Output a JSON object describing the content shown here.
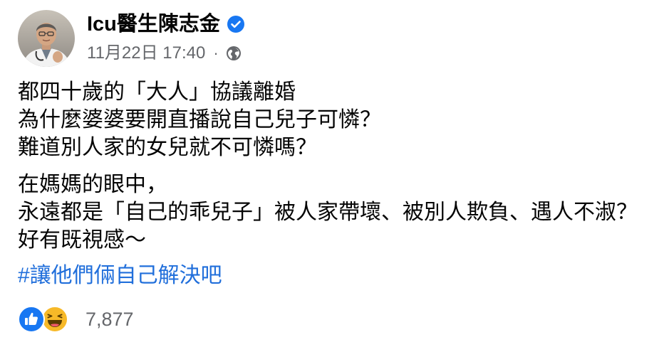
{
  "post": {
    "author": {
      "name": "Icu醫生陳志金",
      "verified": true
    },
    "timestamp": "11月22日 17:40",
    "separator": "·",
    "audience_icon": "globe-icon",
    "paragraphs": [
      {
        "lines": [
          "都四十歲的「大人」協議離婚",
          "為什麼婆婆要開直播說自己兒子可憐？",
          "難道別人家的女兒就不可憐嗎？"
        ]
      },
      {
        "lines": [
          "在媽媽的眼中，",
          "永遠都是「自己的乖兒子」被人家帶壞、被別人欺負、遇人不淑？",
          "好有既視感～"
        ]
      }
    ],
    "hashtag": "#讓他們倆自己解決吧",
    "reactions": {
      "icons": [
        "like-reaction-icon",
        "haha-reaction-icon"
      ],
      "count": "7,877"
    }
  },
  "colors": {
    "text": "#050505",
    "meta": "#65676b",
    "link": "#216fdb",
    "verified": "#1877f2",
    "like": "#1877f2",
    "haha": "#f7b928"
  }
}
